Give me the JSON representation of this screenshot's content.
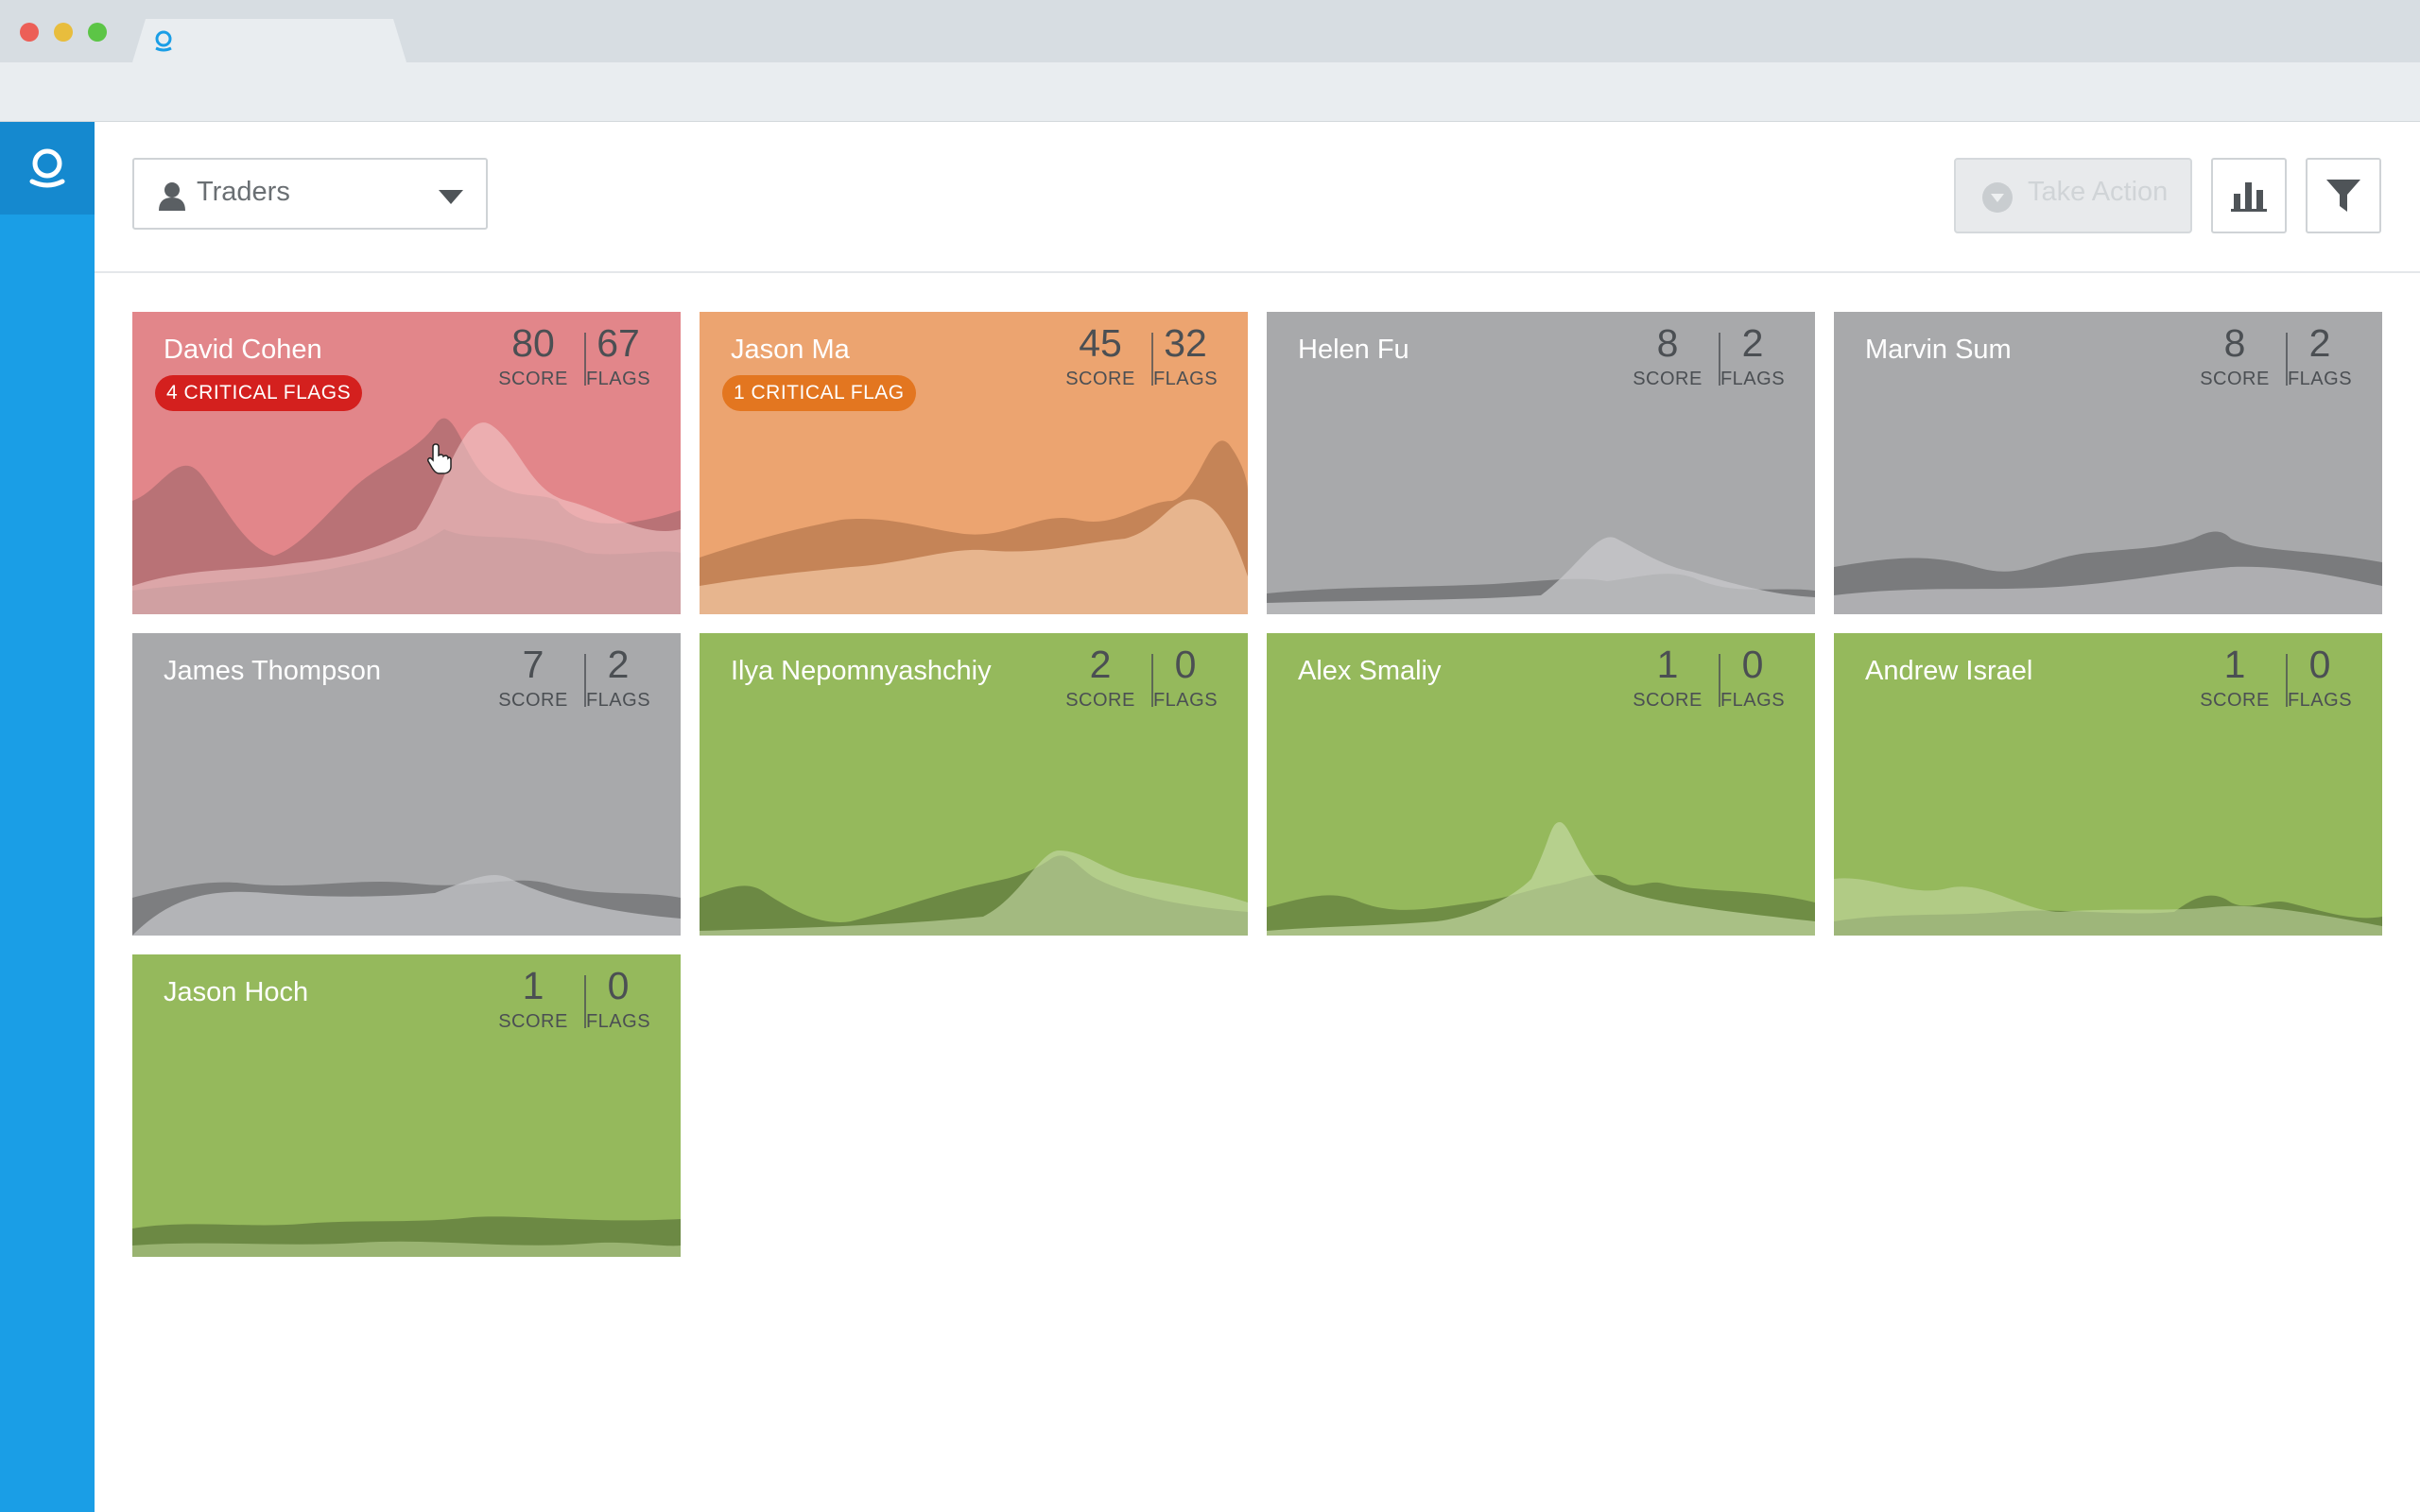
{
  "app": {
    "selector": {
      "label": "Traders"
    },
    "take_action_label": "Take Action",
    "score_label": "SCORE",
    "flags_label": "FLAGS"
  },
  "colors": {
    "red": "#e2868a",
    "orange": "#eca470",
    "gray": "#a8a9ab",
    "green": "#95b95c",
    "accent": "#1a9ee6"
  },
  "traders": [
    {
      "name": "David Cohen",
      "score": "80",
      "flags": "67",
      "badge": "4 CRITICAL FLAGS",
      "status": "red"
    },
    {
      "name": "Jason Ma",
      "score": "45",
      "flags": "32",
      "badge": "1 CRITICAL FLAG",
      "status": "orange"
    },
    {
      "name": "Helen Fu",
      "score": "8",
      "flags": "2",
      "status": "gray"
    },
    {
      "name": "Marvin Sum",
      "score": "8",
      "flags": "2",
      "status": "gray"
    },
    {
      "name": "James Thompson",
      "score": "7",
      "flags": "2",
      "status": "gray"
    },
    {
      "name": "Ilya Nepomnyashchiy",
      "score": "2",
      "flags": "0",
      "status": "green"
    },
    {
      "name": "Alex Smaliy",
      "score": "1",
      "flags": "0",
      "status": "green"
    },
    {
      "name": "Andrew Israel",
      "score": "1",
      "flags": "0",
      "status": "green"
    },
    {
      "name": "Jason Hoch",
      "score": "1",
      "flags": "0",
      "status": "green"
    }
  ]
}
